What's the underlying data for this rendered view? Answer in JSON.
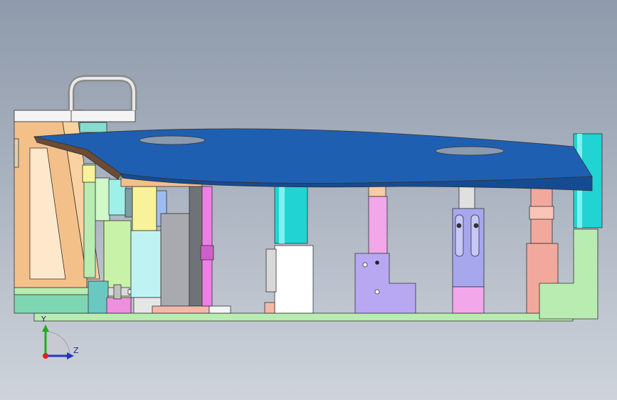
{
  "viewport": {
    "background_top": "#8f9aab",
    "background_bottom": "#cfd4db"
  },
  "model": {
    "panel_color": "#1f5fb2",
    "base_plate_color": "#b8ecb0",
    "cylinder_color": "#22d3d3",
    "bracket_color": "#f4c08a",
    "fixture_block_color": "#a7a7ee",
    "pink_block_color": "#f1a7ea",
    "salmon_post_color": "#f2a89c"
  },
  "axis_triad": {
    "y_label": "Y",
    "z_label": "Z",
    "y_color": "#22aa22",
    "z_color": "#2233cc",
    "origin_color": "#dd2222"
  }
}
